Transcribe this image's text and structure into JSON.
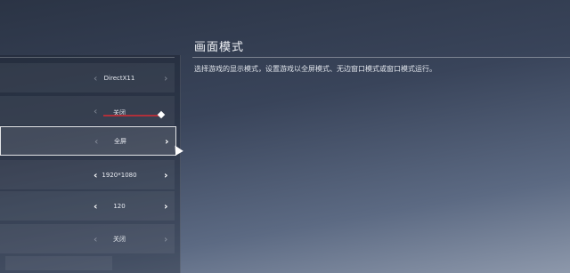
{
  "detail": {
    "title": "画面模式",
    "description": "选择游戏的显示模式，设置游戏以全屏模式、无边窗口模式或窗口模式运行。"
  },
  "settings": [
    {
      "value": "DirectX11"
    },
    {
      "value": "关闭",
      "slider_fraction": 1.0
    },
    {
      "value": "全屏"
    },
    {
      "value": "1920*1080"
    },
    {
      "value": "120"
    },
    {
      "value": "关闭"
    }
  ],
  "icons": {
    "left_arrow": "‹",
    "right_arrow": "›"
  },
  "colors": {
    "slider_fill": "#b0303a",
    "selected_border": "#ffffff"
  }
}
